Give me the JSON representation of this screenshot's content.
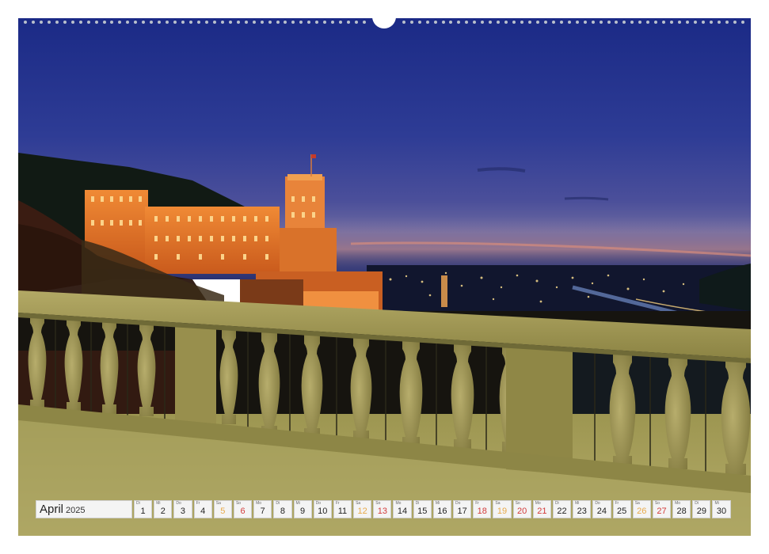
{
  "calendar": {
    "month": "April",
    "year": "2025",
    "days": [
      {
        "wd": "Di",
        "n": "1",
        "type": "weekday"
      },
      {
        "wd": "Mi",
        "n": "2",
        "type": "weekday"
      },
      {
        "wd": "Do",
        "n": "3",
        "type": "weekday"
      },
      {
        "wd": "Fr",
        "n": "4",
        "type": "weekday"
      },
      {
        "wd": "Sa",
        "n": "5",
        "type": "sat"
      },
      {
        "wd": "So",
        "n": "6",
        "type": "sun"
      },
      {
        "wd": "Mo",
        "n": "7",
        "type": "weekday"
      },
      {
        "wd": "Di",
        "n": "8",
        "type": "weekday"
      },
      {
        "wd": "Mi",
        "n": "9",
        "type": "weekday"
      },
      {
        "wd": "Do",
        "n": "10",
        "type": "weekday"
      },
      {
        "wd": "Fr",
        "n": "11",
        "type": "weekday"
      },
      {
        "wd": "Sa",
        "n": "12",
        "type": "sat"
      },
      {
        "wd": "So",
        "n": "13",
        "type": "sun"
      },
      {
        "wd": "Mo",
        "n": "14",
        "type": "weekday"
      },
      {
        "wd": "Di",
        "n": "15",
        "type": "weekday"
      },
      {
        "wd": "Mi",
        "n": "16",
        "type": "weekday"
      },
      {
        "wd": "Do",
        "n": "17",
        "type": "weekday"
      },
      {
        "wd": "Fr",
        "n": "18",
        "type": "hol"
      },
      {
        "wd": "Sa",
        "n": "19",
        "type": "sat"
      },
      {
        "wd": "So",
        "n": "20",
        "type": "sun"
      },
      {
        "wd": "Mo",
        "n": "21",
        "type": "hol"
      },
      {
        "wd": "Di",
        "n": "22",
        "type": "weekday"
      },
      {
        "wd": "Mi",
        "n": "23",
        "type": "weekday"
      },
      {
        "wd": "Do",
        "n": "24",
        "type": "weekday"
      },
      {
        "wd": "Fr",
        "n": "25",
        "type": "weekday"
      },
      {
        "wd": "Sa",
        "n": "26",
        "type": "sat"
      },
      {
        "wd": "So",
        "n": "27",
        "type": "sun"
      },
      {
        "wd": "Mo",
        "n": "28",
        "type": "weekday"
      },
      {
        "wd": "Di",
        "n": "29",
        "type": "weekday"
      },
      {
        "wd": "Mi",
        "n": "30",
        "type": "weekday"
      }
    ]
  },
  "colors": {
    "saturday": "#e7a94a",
    "sunday_holiday": "#d23b3b",
    "sky_top": "#1d2f8a",
    "castle_glow": "#e0762a",
    "balustrade": "#a49b55"
  },
  "photo": {
    "subject": [
      "castle",
      "city-lights",
      "river",
      "balustrade",
      "terrace",
      "night-sky"
    ]
  }
}
